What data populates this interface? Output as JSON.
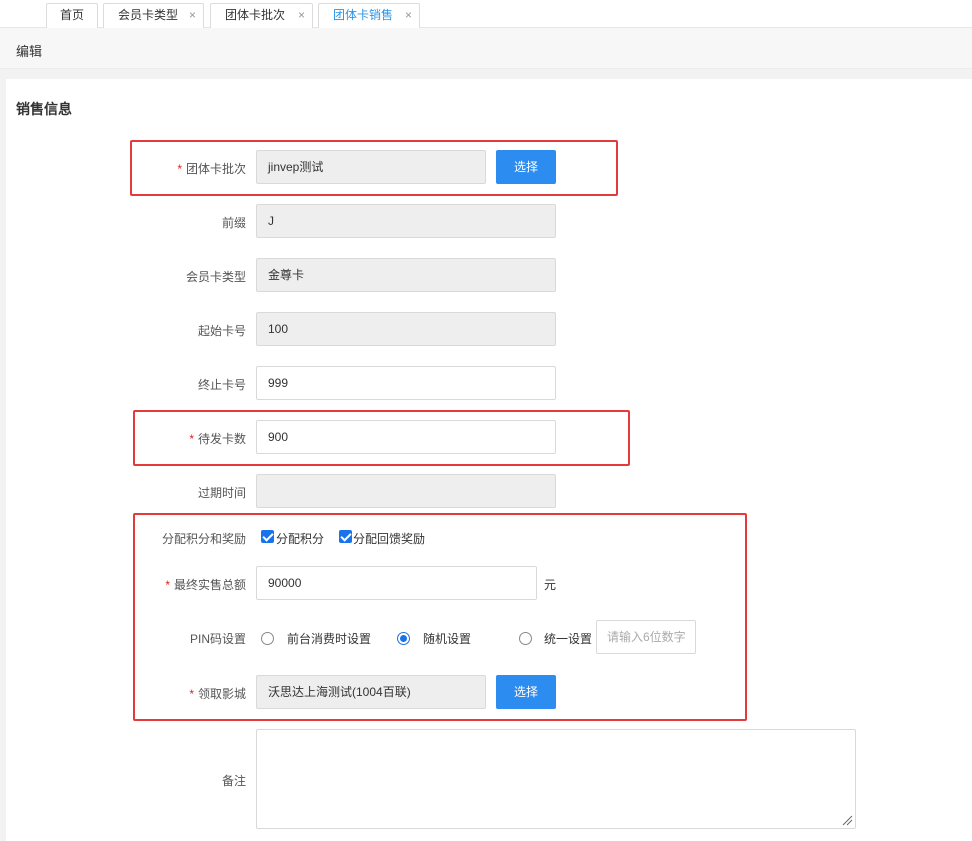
{
  "tabs": [
    {
      "label": "首页"
    },
    {
      "label": "会员卡类型",
      "close": "×"
    },
    {
      "label": "团体卡批次",
      "close": "×"
    },
    {
      "label": "团体卡销售",
      "close": "×"
    }
  ],
  "page": {
    "title": "编辑"
  },
  "section": {
    "title": "销售信息"
  },
  "required_mark": "*",
  "form": {
    "batch": {
      "label": "团体卡批次",
      "value": "jinvep测试",
      "button": "选择"
    },
    "prefix": {
      "label": "前缀",
      "value": "J"
    },
    "card_type": {
      "label": "会员卡类型",
      "value": "金尊卡"
    },
    "start_no": {
      "label": "起始卡号",
      "value": "100"
    },
    "end_no": {
      "label": "终止卡号",
      "value": "999"
    },
    "pending_count": {
      "label": "待发卡数",
      "value": "900"
    },
    "expire": {
      "label": "过期时间",
      "value": ""
    },
    "points": {
      "label": "分配积分和奖励",
      "opt1": "分配积分",
      "opt2": "分配回馈奖励"
    },
    "final_total": {
      "label": "最终实售总额",
      "value": "90000",
      "unit": "元"
    },
    "pin": {
      "label": "PIN码设置",
      "opt1": "前台消费时设置",
      "opt2": "随机设置",
      "opt3": "统一设置",
      "placeholder": "请输入6位数字",
      "selected": "随机设置"
    },
    "cinema": {
      "label": "领取影城",
      "value": "沃思达上海测试(1004百联)",
      "button": "选择"
    },
    "remark": {
      "label": "备注",
      "value": ""
    }
  },
  "colors": {
    "accent": "#2d8cf0",
    "highlight_border": "#e33b3b",
    "required": "#e02020"
  }
}
